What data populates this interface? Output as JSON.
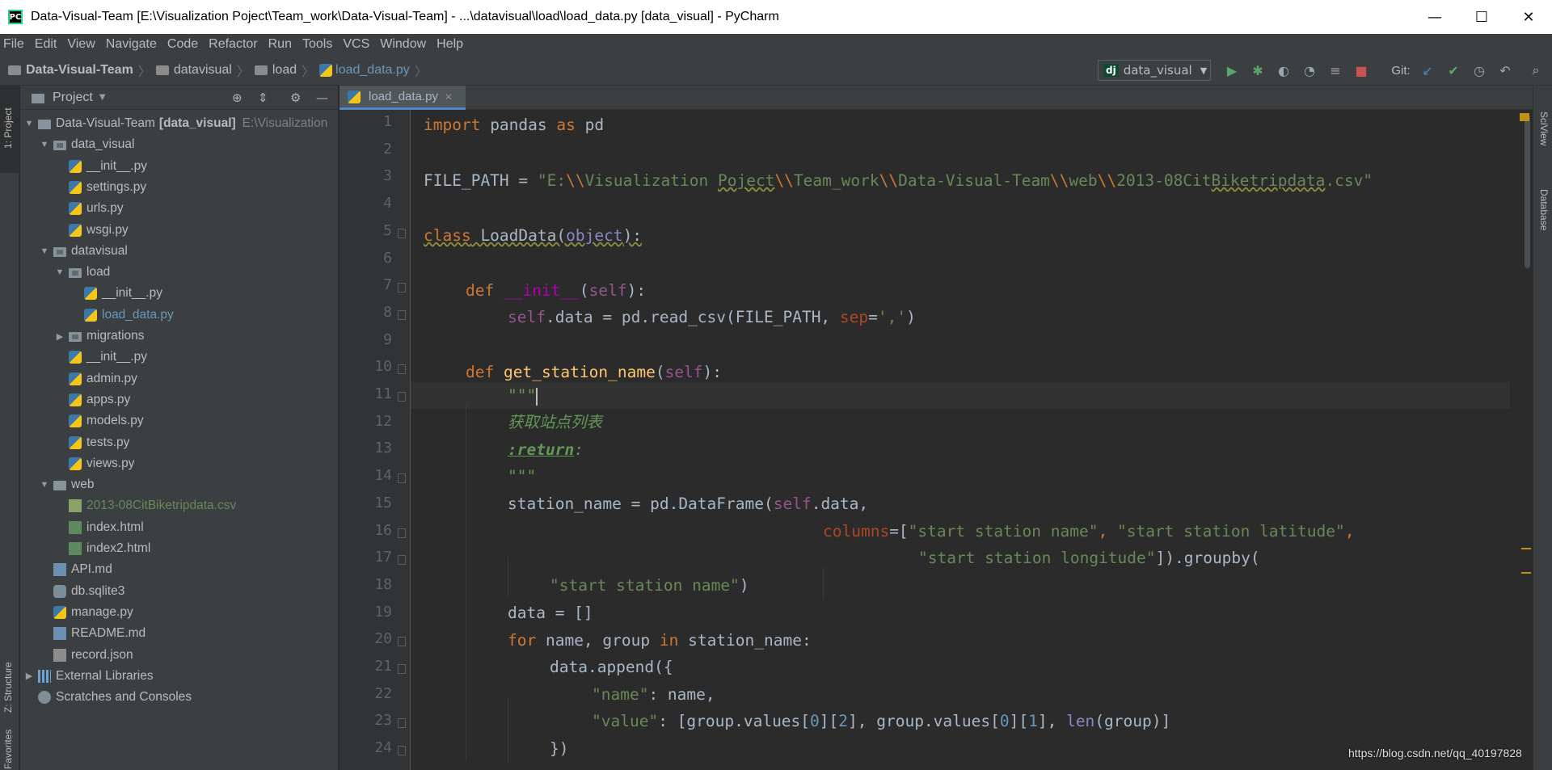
{
  "window": {
    "title": "Data-Visual-Team [E:\\Visualization Poject\\Team_work\\Data-Visual-Team] - ...\\datavisual\\load\\load_data.py [data_visual] - PyCharm",
    "app_icon": "PC"
  },
  "menu": [
    "File",
    "Edit",
    "View",
    "Navigate",
    "Code",
    "Refactor",
    "Run",
    "Tools",
    "VCS",
    "Window",
    "Help"
  ],
  "breadcrumb": [
    "Data-Visual-Team",
    "datavisual",
    "load",
    "load_data.py"
  ],
  "toolbar": {
    "run_config": "data_visual",
    "run_config_badge": "dj",
    "git_label": "Git:"
  },
  "left_tool_tabs": [
    "1: Project",
    "Z: Structure",
    "Favorites"
  ],
  "right_tool_tabs": [
    "SciView",
    "Database"
  ],
  "project": {
    "header": "Project",
    "tree": [
      {
        "label": "Data-Visual-Team",
        "extra_bold": "[data_visual]",
        "extra_muted": "E:\\Visualization",
        "icon": "folder",
        "level": 0,
        "arrow": "▼"
      },
      {
        "label": "data_visual",
        "icon": "folder-pkg",
        "level": 1,
        "arrow": "▼"
      },
      {
        "label": "__init__.py",
        "icon": "python-file-icon",
        "level": 2
      },
      {
        "label": "settings.py",
        "icon": "python-file-icon",
        "level": 2
      },
      {
        "label": "urls.py",
        "icon": "python-file-icon",
        "level": 2
      },
      {
        "label": "wsgi.py",
        "icon": "python-file-icon",
        "level": 2
      },
      {
        "label": "datavisual",
        "icon": "folder-pkg",
        "level": 1,
        "arrow": "▼"
      },
      {
        "label": "load",
        "icon": "folder-pkg",
        "level": 2,
        "arrow": "▼"
      },
      {
        "label": "__init__.py",
        "icon": "python-file-icon",
        "level": 3
      },
      {
        "label": "load_data.py",
        "icon": "python-file-icon",
        "level": 3,
        "selected": true
      },
      {
        "label": "migrations",
        "icon": "folder-pkg",
        "level": 2,
        "arrow": "▶"
      },
      {
        "label": "__init__.py",
        "icon": "python-file-icon",
        "level": 2
      },
      {
        "label": "admin.py",
        "icon": "python-file-icon",
        "level": 2
      },
      {
        "label": "apps.py",
        "icon": "python-file-icon",
        "level": 2
      },
      {
        "label": "models.py",
        "icon": "python-file-icon",
        "level": 2
      },
      {
        "label": "tests.py",
        "icon": "python-file-icon",
        "level": 2
      },
      {
        "label": "views.py",
        "icon": "python-file-icon",
        "level": 2
      },
      {
        "label": "web",
        "icon": "folder",
        "level": 1,
        "arrow": "▼"
      },
      {
        "label": "2013-08CitBiketripdata.csv",
        "icon": "csv-file-icon",
        "level": 2,
        "color": "#6a8759"
      },
      {
        "label": "index.html",
        "icon": "html-file-icon",
        "level": 2
      },
      {
        "label": "index2.html",
        "icon": "html-file-icon",
        "level": 2
      },
      {
        "label": "API.md",
        "icon": "markdown-file-icon",
        "level": 1
      },
      {
        "label": "db.sqlite3",
        "icon": "database-file-icon",
        "level": 1
      },
      {
        "label": "manage.py",
        "icon": "python-file-icon",
        "level": 1
      },
      {
        "label": "README.md",
        "icon": "markdown-file-icon",
        "level": 1
      },
      {
        "label": "record.json",
        "icon": "json-file-icon",
        "level": 1
      },
      {
        "label": "External Libraries",
        "icon": "library-icon",
        "level": 0,
        "arrow": "▶"
      },
      {
        "label": "Scratches and Consoles",
        "icon": "scratch-icon",
        "level": 0
      }
    ]
  },
  "editor": {
    "tab_label": "load_data.py",
    "line_numbers": [
      "1",
      "2",
      "3",
      "4",
      "5",
      "6",
      "7",
      "8",
      "9",
      "10",
      "11",
      "12",
      "13",
      "14",
      "15",
      "16",
      "17",
      "18",
      "19",
      "20",
      "21",
      "22",
      "23",
      "24"
    ],
    "code": {
      "l1": {
        "a": "import",
        "b": " pandas ",
        "c": "as",
        "d": " pd"
      },
      "l3": {
        "a": "FILE_PATH = ",
        "b": "\"E:",
        "c": "\\\\",
        "d": "Visualization ",
        "e": "Poject",
        "f": "\\\\",
        "g": "Team_work",
        "h": "\\\\",
        "i": "Data-Visual-Team",
        "j": "\\\\",
        "k": "web",
        "l": "\\\\",
        "m": "2013-08Cit",
        "n": "Biketripdata",
        "o": ".csv\""
      },
      "l5": {
        "a": "class",
        "b": " LoadData(",
        "c": "object",
        "d": "):"
      },
      "l7": {
        "a": "def",
        "b": " ",
        "c": "__init__",
        "d": "(",
        "e": "self",
        "f": "):"
      },
      "l8": {
        "a": "self",
        "b": ".data = pd.read_csv(FILE_PATH, ",
        "c": "sep",
        "d": "=",
        "e": "','",
        "f": ")"
      },
      "l10": {
        "a": "def",
        "b": " ",
        "c": "get_station_name",
        "d": "(",
        "e": "self",
        "f": "):"
      },
      "l11": {
        "a": "\"\"\""
      },
      "l12": {
        "a": "获取站点列表"
      },
      "l13": {
        "a": ":return",
        "b": ":"
      },
      "l14": {
        "a": "\"\"\""
      },
      "l15": {
        "a": "station_name = pd.DataFrame(",
        "b": "self",
        "c": ".data,"
      },
      "l16": {
        "a": "columns",
        "b": "=[",
        "c": "\"start station name\"",
        "d": ", ",
        "e": "\"start station latitude\"",
        "f": ","
      },
      "l17": {
        "a": "\"start station longitude\"",
        "b": "]).groupby("
      },
      "l18": {
        "a": "\"start station name\"",
        "b": ")"
      },
      "l19": {
        "a": "data = []"
      },
      "l20": {
        "a": "for",
        "b": " name, group ",
        "c": "in",
        "d": " station_name:"
      },
      "l21": {
        "a": "data.append({"
      },
      "l22": {
        "a": "\"name\"",
        "b": ": name,"
      },
      "l23": {
        "a": "\"value\"",
        "b": ": [group.values[",
        "c": "0",
        "d": "][",
        "e": "2",
        "f": "], group.values[",
        "g": "0",
        "h": "][",
        "i": "1",
        "j": "], ",
        "k": "len",
        "l": "(group)]"
      },
      "l24": {
        "a": "})"
      }
    }
  },
  "watermark": "https://blog.csdn.net/qq_40197828",
  "colors": {
    "keyword": "#cc7832",
    "string": "#6a8759",
    "function": "#ffc66d",
    "self": "#94558d",
    "number": "#6897bb",
    "accent": "#4a88c7"
  }
}
